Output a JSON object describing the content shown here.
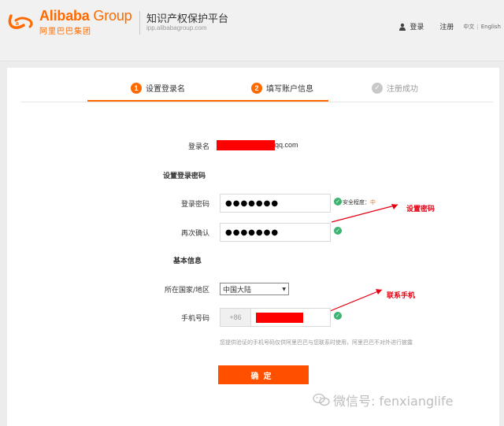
{
  "header": {
    "brand_en_main": "Alibaba",
    "brand_en_group": " Group",
    "brand_cn": "阿里巴巴集团",
    "platform_title": "知识产权保护平台",
    "platform_url": "ipp.alibabagroup.com",
    "login_label": "登录",
    "register_label": "注册",
    "lang_cn": "中文",
    "lang_sep": "|",
    "lang_en": "English"
  },
  "steps": [
    {
      "num": "1",
      "label": "设置登录名"
    },
    {
      "num": "2",
      "label": "填写账户信息"
    },
    {
      "num": "✓",
      "label": "注册成功"
    }
  ],
  "form": {
    "username_label": "登录名",
    "username_suffix": "qq.com",
    "set_password_title": "设置登录密码",
    "password_label": "登录密码",
    "password_value": "●●●●●●●",
    "strength_label": "安全程度：",
    "strength_level": "中",
    "confirm_label": "再次确认",
    "confirm_value": "●●●●●●●",
    "basic_info_title": "基本信息",
    "country_label": "所在国家/地区",
    "country_value": "中国大陆",
    "phone_label": "手机号码",
    "phone_prefix": "+86",
    "phone_hint": "您提供验证的手机号码仅供阿里巴巴与您联系时使用，阿里巴巴不对外进行披露",
    "submit_label": "确定"
  },
  "annotations": {
    "set_password": "设置密码",
    "contact_phone": "联系手机"
  },
  "watermark": {
    "text": "微信号: fenxianglife"
  },
  "colors": {
    "brand": "#ff6a00",
    "button": "#ff5000",
    "success": "#3cb371",
    "annotation": "#e60012"
  }
}
